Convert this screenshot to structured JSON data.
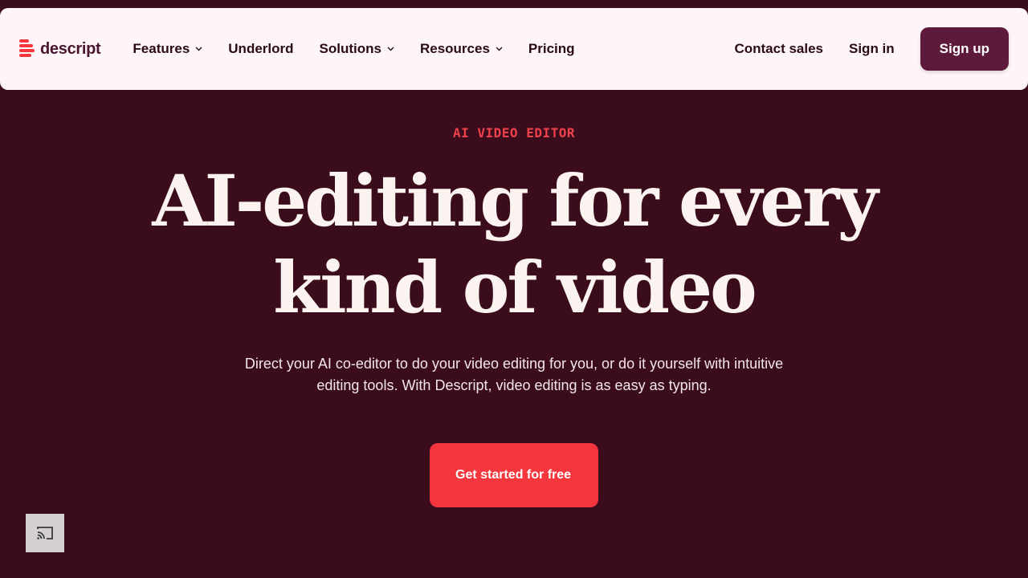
{
  "header": {
    "logo_text": "descript",
    "nav": [
      {
        "label": "Features",
        "dropdown": true
      },
      {
        "label": "Underlord",
        "dropdown": false
      },
      {
        "label": "Solutions",
        "dropdown": true
      },
      {
        "label": "Resources",
        "dropdown": true
      },
      {
        "label": "Pricing",
        "dropdown": false
      }
    ],
    "contact_sales": "Contact sales",
    "sign_in": "Sign in",
    "sign_up": "Sign up"
  },
  "hero": {
    "eyebrow": "AI VIDEO EDITOR",
    "headline_line1": "AI-editing for every",
    "headline_line2": "kind of video",
    "subtext": "Direct your AI co-editor to do your video editing for you, or do it yourself with intuitive editing tools. With Descript, video editing is as easy as typing.",
    "cta_label": "Get started for free"
  },
  "icons": {
    "logo": "descript-logo-icon",
    "dropdown": "chevron-down-icon",
    "cast": "cast-icon"
  },
  "colors": {
    "background": "#3a0c1c",
    "nav_background": "#fdf5f7",
    "accent": "#f5363d",
    "sign_up_button": "#5e1a3a",
    "headline": "#fbf3ef"
  }
}
